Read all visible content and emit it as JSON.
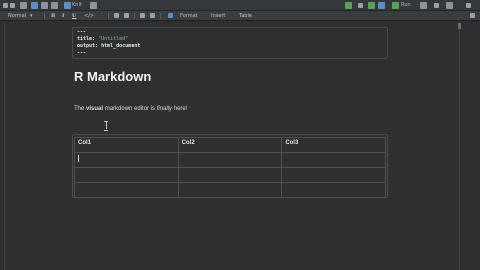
{
  "toolbar_top": {
    "go_to_file": "Go to file/function",
    "addins": "Addins",
    "knit": "Knit",
    "run": "Run"
  },
  "toolbar_format": {
    "style": "Normal",
    "bold": "B",
    "italic": "I",
    "underline": "U",
    "code": "</>",
    "format_menu": "Format",
    "insert_menu": "Insert",
    "table_menu": "Table"
  },
  "yaml": {
    "open": "---",
    "title_key": "title:",
    "title_value": "\"Untitled\"",
    "output_key": "output:",
    "output_value": "html_document",
    "close": "---"
  },
  "heading": "R Markdown",
  "paragraph": {
    "pre": "The ",
    "bold": "visual",
    "mid": " markdown editor is ",
    "italic": "finally",
    "post": " here!"
  },
  "table": {
    "headers": [
      "Col1",
      "Col2",
      "Col3"
    ],
    "rows": [
      [
        "",
        "",
        ""
      ],
      [
        "",
        "",
        ""
      ],
      [
        "",
        "",
        ""
      ]
    ]
  },
  "colors": {
    "background": "#2d2f30",
    "yaml_string": "#7ec37e",
    "text": "#dcdcdc"
  }
}
